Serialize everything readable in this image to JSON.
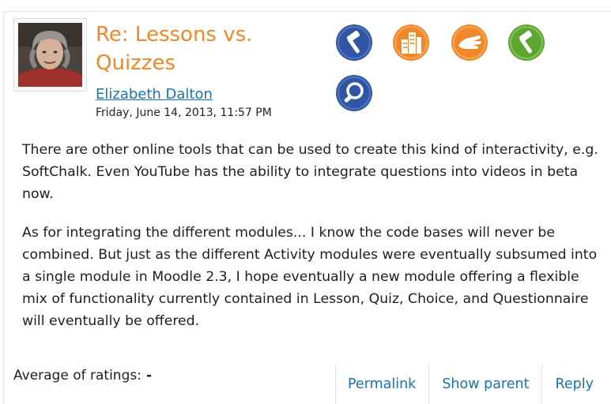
{
  "post": {
    "subject": "Re: Lessons vs. Quizzes",
    "author": "Elizabeth Dalton",
    "date": "Friday, June 14, 2013, 11:57 PM",
    "paragraphs": [
      "There are other online tools that can be used to create this kind of interactivity, e.g. SoftChalk. Even YouTube has the ability to integrate questions into videos in beta now.",
      "As for integrating the different modules... I know the code bases will never be combined. But just as the different Activity modules were eventually subsumed into a single module in Moodle 2.3, I hope eventually a new module offering a flexible mix of functionality currently contained in Lesson, Quiz, Choice, and Questionnaire will eventually be offered."
    ]
  },
  "badges": [
    {
      "icon": "hammer-badge-icon",
      "color": "#2f55a4"
    },
    {
      "icon": "buildings-badge-icon",
      "color": "#f0882a"
    },
    {
      "icon": "handshake-badge-icon",
      "color": "#f0882a"
    },
    {
      "icon": "hammer-green-badge-icon",
      "color": "#5fa532"
    },
    {
      "icon": "magnifier-badge-icon",
      "color": "#2f55a4"
    }
  ],
  "ratings": {
    "label": "Average of ratings:",
    "value": "-"
  },
  "commands": {
    "permalink": "Permalink",
    "show_parent": "Show parent",
    "reply": "Reply"
  },
  "colors": {
    "subject": "#f0882a",
    "link": "#1a72b5"
  }
}
